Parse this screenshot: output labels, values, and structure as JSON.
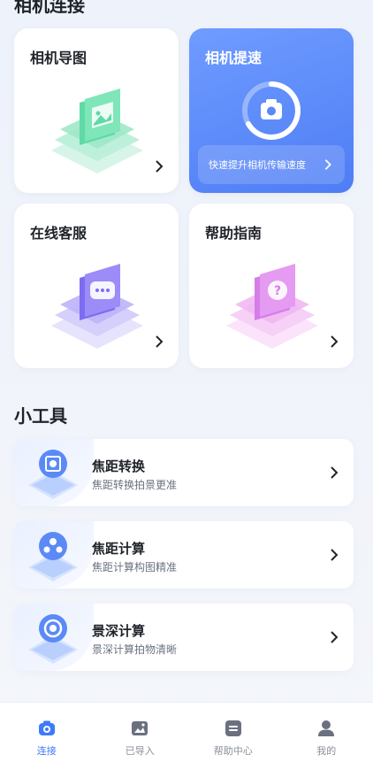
{
  "sections": {
    "camera_connect": "相机连接",
    "tools": "小工具"
  },
  "cards": [
    {
      "title": "相机导图"
    },
    {
      "title": "相机提速",
      "subtitle": "快速提升相机传输速度"
    },
    {
      "title": "在线客服"
    },
    {
      "title": "帮助指南"
    }
  ],
  "tools": [
    {
      "name": "焦距转换",
      "desc": "焦距转换拍景更准"
    },
    {
      "name": "焦距计算",
      "desc": "焦距计算构图精准"
    },
    {
      "name": "景深计算",
      "desc": "景深计算拍物清晰"
    }
  ],
  "tabs": [
    {
      "label": "连接",
      "icon": "camera-icon",
      "active": true
    },
    {
      "label": "已导入",
      "icon": "image-icon",
      "active": false
    },
    {
      "label": "帮助中心",
      "icon": "help-doc-icon",
      "active": false
    },
    {
      "label": "我的",
      "icon": "user-icon",
      "active": false
    }
  ],
  "colors": {
    "accent": "#3e7bfa",
    "speed_card": "#5b8af7",
    "guide": "#4fd6a6",
    "service": "#8b7cf6",
    "help": "#d98af0"
  }
}
